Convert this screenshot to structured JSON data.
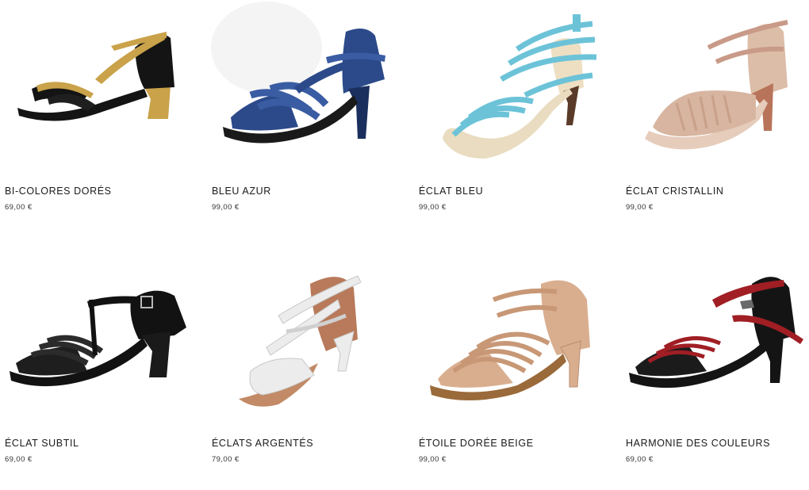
{
  "products": [
    {
      "name": "BI-COLORES DORÉS",
      "price": "69,00 €",
      "icon": "black-gold-sandal",
      "colors": {
        "main": "#141414",
        "accent": "#c9a24a"
      }
    },
    {
      "name": "BLEU AZUR",
      "price": "99,00 €",
      "icon": "blue-denim-sandal",
      "colors": {
        "main": "#2c4a8a",
        "accent": "#1b2f5e"
      }
    },
    {
      "name": "ÉCLAT BLEU",
      "price": "99,00 €",
      "icon": "blue-sparkle-sandal",
      "colors": {
        "main": "#6cc3d8",
        "accent": "#e9dcc0"
      }
    },
    {
      "name": "ÉCLAT CRISTALLIN",
      "price": "99,00 €",
      "icon": "nude-crystal-sandal",
      "colors": {
        "main": "#d7b5a0",
        "accent": "#b8745a"
      }
    },
    {
      "name": "ÉCLAT SUBTIL",
      "price": "69,00 €",
      "icon": "black-satin-sandal",
      "colors": {
        "main": "#121212",
        "accent": "#333333"
      }
    },
    {
      "name": "ÉCLATS ARGENTÉS",
      "price": "79,00 €",
      "icon": "silver-white-sandal",
      "colors": {
        "main": "#ececec",
        "accent": "#b87a5a"
      }
    },
    {
      "name": "ÉTOILE DORÉE BEIGE",
      "price": "99,00 €",
      "icon": "beige-gold-sandal",
      "colors": {
        "main": "#d9ae8f",
        "accent": "#9a6a3a"
      }
    },
    {
      "name": "HARMONIE DES COULEURS",
      "price": "69,00 €",
      "icon": "black-red-sandal",
      "colors": {
        "main": "#141414",
        "accent": "#a01e24"
      }
    }
  ]
}
